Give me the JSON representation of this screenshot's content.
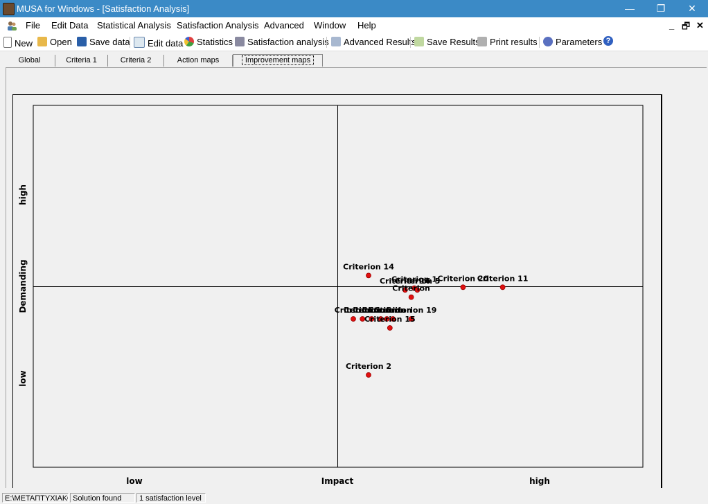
{
  "window": {
    "title": "MUSA for Windows - [Satisfaction Analysis]",
    "minimize": "—",
    "maximize": "❐",
    "close": "✕"
  },
  "menu": [
    {
      "label": "File"
    },
    {
      "label": "Edit Data"
    },
    {
      "label": "Statistical Analysis"
    },
    {
      "label": "Satisfaction Analysis"
    },
    {
      "label": "Advanced"
    },
    {
      "label": "Window"
    },
    {
      "label": "Help"
    }
  ],
  "mdi_controls": {
    "minimize": "_",
    "restore": "🗗",
    "close": "✕"
  },
  "toolbar": {
    "new": "New",
    "open": "Open",
    "save_data": "Save data",
    "edit_data": "Edit data",
    "statistics": "Statistics",
    "satisfaction_analysis": "Satisfaction analysis",
    "advanced_results": "Advanced Results",
    "save_results": "Save Results",
    "print_results": "Print results",
    "parameters": "Parameters",
    "help": "?"
  },
  "tabs": [
    {
      "label": "Global"
    },
    {
      "label": "Criteria 1"
    },
    {
      "label": "Criteria 2"
    },
    {
      "label": "Action maps"
    },
    {
      "label": "Improvement maps",
      "active": true
    }
  ],
  "chart_data": {
    "type": "scatter",
    "xlabel": "Impact",
    "ylabel": "Demanding",
    "x_tick_labels": {
      "low": "low",
      "high": "high"
    },
    "y_tick_labels": {
      "low": "low",
      "high": "high"
    },
    "xlim": [
      -1,
      1
    ],
    "ylim": [
      -1,
      1
    ],
    "quadrant_lines": true,
    "marker_color": "#e01010",
    "points": [
      {
        "label": "Criterion 14",
        "x": 0.1,
        "y": 0.06
      },
      {
        "label": "Criterion 1",
        "x": 0.25,
        "y": -0.01
      },
      {
        "label": "Criterion 5",
        "x": 0.26,
        "y": -0.02
      },
      {
        "label": "Criterion 16",
        "x": 0.22,
        "y": -0.02
      },
      {
        "label": "",
        "x": 0.24,
        "y": -0.06
      },
      {
        "label": "Criterion 20",
        "x": 0.41,
        "y": -0.005
      },
      {
        "label": "Criterion 11",
        "x": 0.54,
        "y": -0.005
      },
      {
        "label": "",
        "x": 0.05,
        "y": -0.18
      },
      {
        "label": "",
        "x": 0.08,
        "y": -0.18
      },
      {
        "label": "",
        "x": 0.11,
        "y": -0.18
      },
      {
        "label": "",
        "x": 0.14,
        "y": -0.18
      },
      {
        "label": "",
        "x": 0.16,
        "y": -0.18
      },
      {
        "label": "",
        "x": 0.18,
        "y": -0.18
      },
      {
        "label": "Criterion 19",
        "x": 0.24,
        "y": -0.18
      },
      {
        "label": "Criterion 15",
        "x": 0.17,
        "y": -0.23
      },
      {
        "label": "Criterion 2",
        "x": 0.1,
        "y": -0.49
      }
    ],
    "overlap_label": "Criterion"
  },
  "status": {
    "path": "E:\\ΜΕΤΑΠΤΥΧΙΑΚΟ",
    "message": "Solution found",
    "levels": "1 satisfaction level"
  }
}
